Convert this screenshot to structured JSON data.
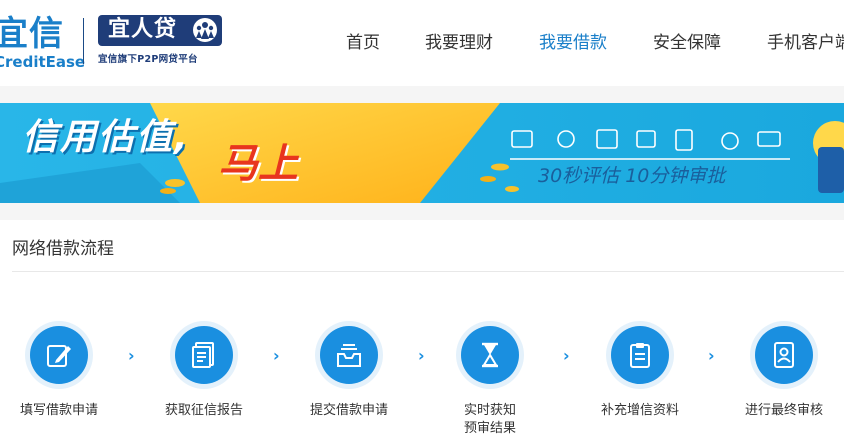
{
  "brand": {
    "creditease_cn": "宜信",
    "creditease_en": "CreditEase",
    "yirendai_name": "宜人贷",
    "yirendai_tagline": "宜信旗下P2P网贷平台"
  },
  "nav": {
    "items": [
      {
        "label": "首页",
        "active": false
      },
      {
        "label": "我要理财",
        "active": false
      },
      {
        "label": "我要借款",
        "active": true
      },
      {
        "label": "安全保障",
        "active": false
      },
      {
        "label": "手机客户端",
        "active": false
      }
    ]
  },
  "banner": {
    "headline": "信用估值,",
    "headline_accent": "马上",
    "subline": "30秒评估 10分钟审批"
  },
  "process": {
    "title": "网络借款流程",
    "steps": [
      {
        "label": "填写借款申请",
        "icon": "pen-icon"
      },
      {
        "label": "获取征信报告",
        "icon": "report-icon"
      },
      {
        "label": "提交借款申请",
        "icon": "inbox-icon"
      },
      {
        "label": "实时获知\n预审结果",
        "icon": "hourglass-icon"
      },
      {
        "label": "补充增信资料",
        "icon": "clipboard-icon"
      },
      {
        "label": "进行最终审核",
        "icon": "id-card-icon"
      }
    ],
    "arrow_glyph": "›"
  },
  "colors": {
    "brand_blue": "#1a7fc9",
    "navy": "#1f3d79",
    "step_blue": "#1a8fe0",
    "accent_red": "#e8351e"
  }
}
